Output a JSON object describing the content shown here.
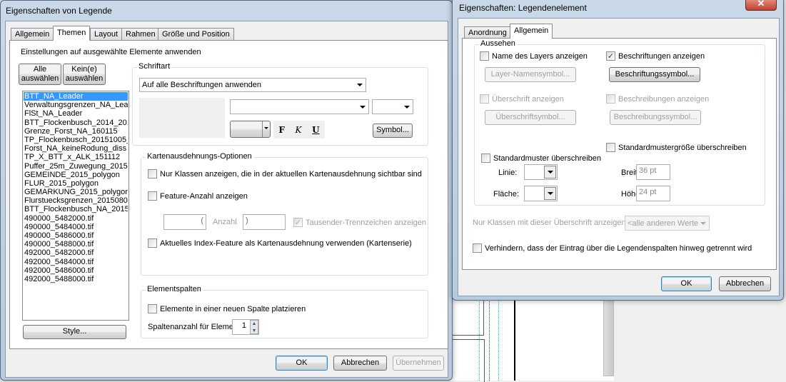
{
  "background": {
    "blurred_title": "92000_5486000.tif"
  },
  "left_dialog": {
    "title": "Eigenschaften von Legende",
    "tabs": [
      "Allgemein",
      "Themen",
      "Layout",
      "Rahmen",
      "Größe und Position"
    ],
    "active_tab": "Themen",
    "heading": "Einstellungen auf ausgewählte Elemente anwenden",
    "select_all": "Alle auswählen",
    "select_none": "Kein(e) auswählen",
    "items": [
      "BTT_NA_Leader",
      "Verwaltungsgrenzen_NA_Leader",
      "FlSt_NA_Leader",
      "BTT_Flockenbusch_2014_2015",
      "Grenze_Forst_NA_160115",
      "TP_Flockenbusch_20151005_F",
      "Forst_NA_keineRodung_diss",
      "TP_X_BTT_x_ALK_151112",
      "Puffer_25m_Zuwegung_2015",
      "GEMEINDE_2015_polygon",
      "FLUR_2015_polygon",
      "GEMARKUNG_2015_polygon",
      "Flurstuecksgrenzen_20150807",
      "BTT_Flockenbusch_NA_2015_",
      "490000_5482000.tif",
      "490000_5484000.tif",
      "490000_5486000.tif",
      "490000_5488000.tif",
      "492000_5482000.tif",
      "492000_5484000.tif",
      "492000_5486000.tif",
      "492000_5488000.tif"
    ],
    "selected_item": "BTT_NA_Leader",
    "style_button": "Style...",
    "font_group": {
      "label": "Schriftart",
      "apply_combo": "Auf alle Beschriftungen anwenden",
      "bold": "F",
      "italic": "K",
      "underline": "U",
      "symbol_button": "Symbol..."
    },
    "extent_group": {
      "label": "Kartenausdehnungs-Optionen",
      "only_visible": "Nur Klassen anzeigen, die in der aktuellen Kartenausdehnung sichtbar sind",
      "feature_count": "Feature-Anzahl anzeigen",
      "prefix": "(",
      "count_label": "Anzahl",
      "suffix": ")",
      "thousands": "Tausender-Trennzeichen anzeigen",
      "index_feature": "Aktuelles Index-Feature als Kartenausdehnung verwenden (Kartenserie)"
    },
    "columns_group": {
      "label": "Elementspalten",
      "new_column": "Elemente in einer neuen Spalte platzieren",
      "count_label": "Spaltenanzahl für Elemente",
      "count_value": "1"
    },
    "ok": "OK",
    "cancel": "Abbrechen",
    "apply": "Übernehmen"
  },
  "right_dialog": {
    "title": "Eigenschaften: Legendenelement",
    "tabs": [
      "Anordnung",
      "Allgemein"
    ],
    "active_tab": "Allgemein",
    "group_label": "Aussehen",
    "show_layer_name": "Name des Layers anzeigen",
    "layer_name_symbol": "Layer-Namensymbol...",
    "show_labels": "Beschriftungen anzeigen",
    "label_symbol": "Beschriftungssymbol...",
    "show_heading": "Überschrift anzeigen",
    "heading_symbol": "Überschriftsymbol...",
    "show_descriptions": "Beschreibungen anzeigen",
    "description_symbol": "Beschreibungssymbol...",
    "override_patch_size": "Standardmustergröße überschreiben",
    "override_patch": "Standardmuster überschreiben",
    "line_label": "Linie:",
    "area_label": "Fläche:",
    "width_label": "Breite:",
    "width_value": "36 pt",
    "height_label": "Höhe:",
    "height_value": "24 pt",
    "heading_filter_label": "Nur Klassen mit dieser Überschrift anzeigen:",
    "heading_filter_value": "<alle anderen Werte",
    "prevent_split": "Verhindern, dass der Eintrag über die Legendenspalten hinweg getrennt wird",
    "ok": "OK",
    "cancel": "Abbrechen"
  }
}
